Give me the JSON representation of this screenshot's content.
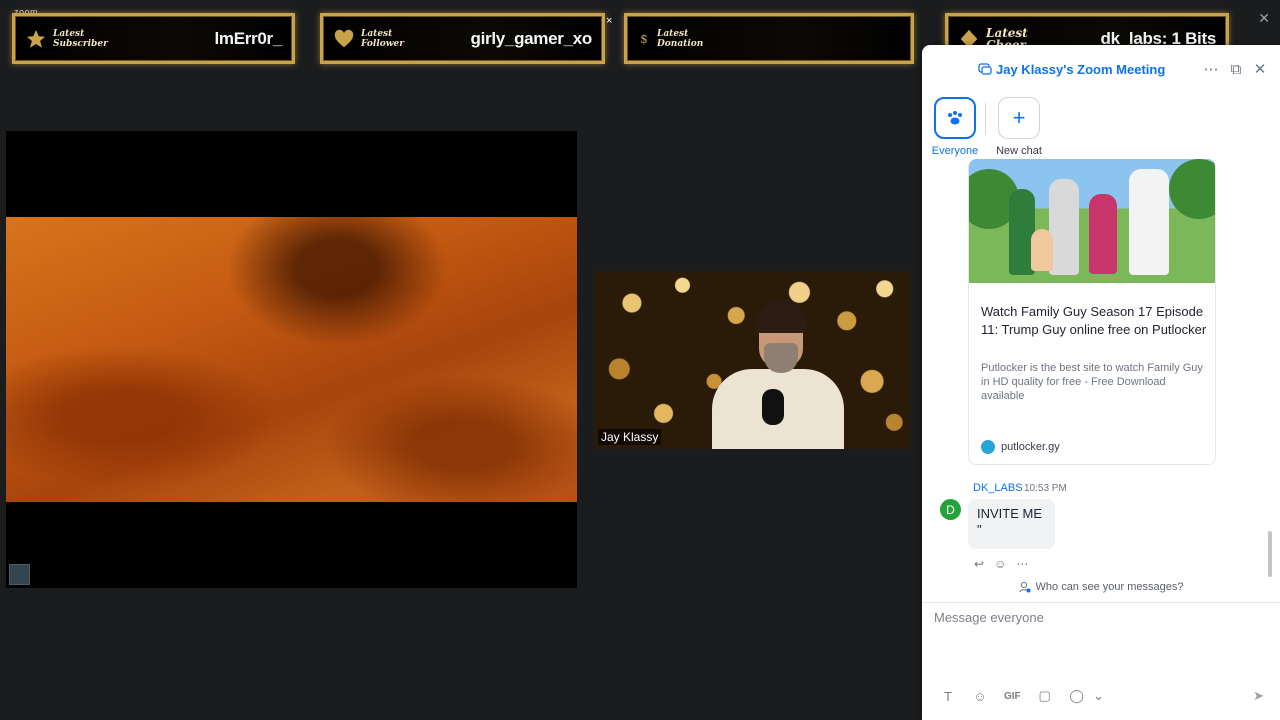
{
  "app": {
    "label": "zoom",
    "close_glyph": "✕"
  },
  "stream_overlay": {
    "latest_subscriber": {
      "title": "Latest Subscriber",
      "value": "lmErr0r_",
      "icon": "star-icon"
    },
    "latest_follower": {
      "title": "Latest Follower",
      "value": "girly_gamer_xo",
      "icon": "heart-icon"
    },
    "latest_donation": {
      "title": "Latest Donation",
      "value": "",
      "icon": "dollar-icon"
    },
    "latest_cheer": {
      "title": "Latest Cheer",
      "value": "dk_labs: 1 Bits",
      "icon": "diamond-icon"
    },
    "close_glyph": "×",
    "accent_color": "#c9a24a"
  },
  "participant": {
    "name": "Jay Klassy"
  },
  "chat": {
    "title": "Jay Klassy's Zoom Meeting",
    "header_buttons": {
      "more": "⋯",
      "popout": "⧉",
      "close": "✕"
    },
    "tabs": [
      {
        "label": "Everyone",
        "active": true,
        "icon": "paw-icon"
      },
      {
        "label": "New chat",
        "active": false,
        "icon": "plus-icon",
        "glyph": "+"
      }
    ],
    "link_preview": {
      "title": "Watch Family Guy Season 17 Episode 11: Trump Guy online free on Putlocker",
      "description": "Putlocker is the best site to watch Family Guy in HD quality for free - Free Download available",
      "domain": "putlocker.gy"
    },
    "message": {
      "avatar_initial": "D",
      "sender": "DK_LABS",
      "time": "10:53 PM",
      "lines": [
        "INVITE ME",
        "\""
      ],
      "actions": [
        "↩",
        "☺",
        "⋯"
      ]
    },
    "visibility_text": "Who can see your messages?",
    "composer": {
      "placeholder": "Message everyone",
      "tools": [
        "T",
        "☺",
        "GIF",
        "▢",
        "◯",
        "⌄"
      ],
      "send_glyph": "➤"
    },
    "accent_color": "#0e72ed"
  }
}
